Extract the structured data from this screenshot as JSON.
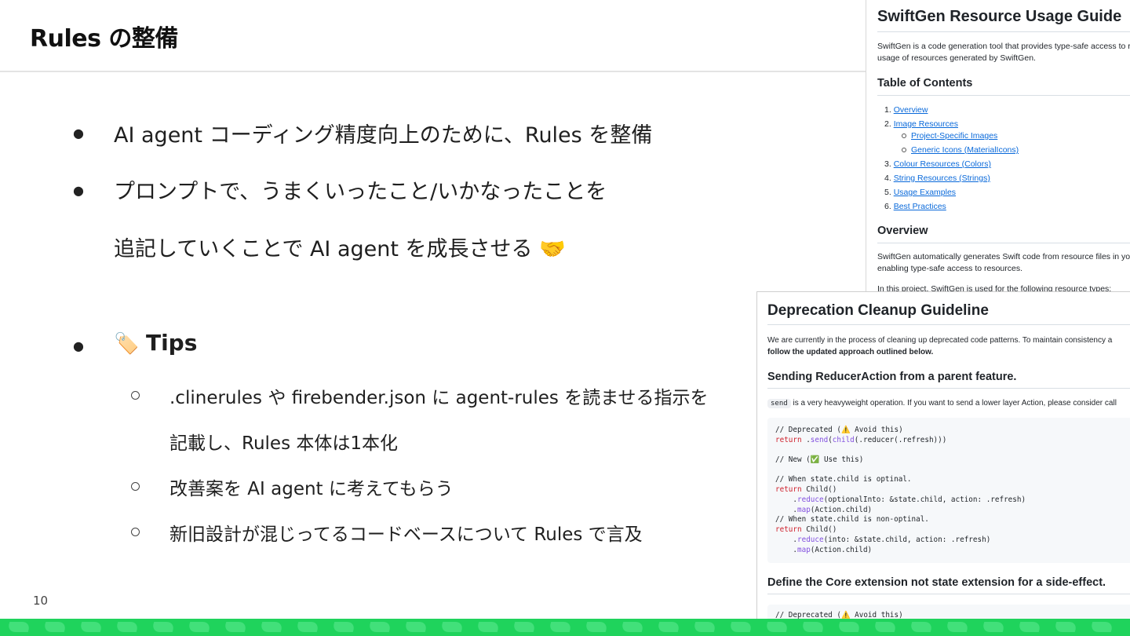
{
  "slide": {
    "title": "Rules の整備",
    "page_number": "10",
    "bullets": [
      {
        "text": "AI agent コーディング精度向上のために、Rules を整備"
      },
      {
        "text_line1": "プロンプトで、うまくいったこと/いかなったことを",
        "text_line2": "追記していくことで AI agent を成長させる 🤝"
      }
    ],
    "tips": {
      "emoji": "🏷️",
      "label": "Tips",
      "items": [
        {
          "line1": ".clinerules や firebender.json に agent-rules を読ませる指示を",
          "line2": "記載し、Rules 本体は1本化"
        },
        {
          "line1": "改善案を AI agent に考えてもらう"
        },
        {
          "line1": "新旧設計が混じってるコードベースについて Rules で言及"
        }
      ]
    },
    "colors": {
      "footer_band": "#1fd35c",
      "leaf": "#42e07a"
    }
  },
  "screenshot1": {
    "title": "SwiftGen Resource Usage Guide",
    "intro_line1": "SwiftGen is a code generation tool that provides type-safe access to r",
    "intro_line2": "usage of resources generated by SwiftGen.",
    "toc_heading": "Table of Contents",
    "toc": [
      {
        "num": "1.",
        "label": "Overview"
      },
      {
        "num": "2.",
        "label": "Image Resources"
      },
      {
        "sub": true,
        "label": "Project-Specific Images"
      },
      {
        "sub": true,
        "label": "Generic Icons (MaterialIcons)"
      },
      {
        "num": "3.",
        "label": "Colour Resources (Colors)"
      },
      {
        "num": "4.",
        "label": "String Resources (Strings)"
      },
      {
        "num": "5.",
        "label": "Usage Examples"
      },
      {
        "num": "6.",
        "label": "Best Practices"
      }
    ],
    "overview_heading": "Overview",
    "overview_line1": "SwiftGen automatically generates Swift code from resource files in yo",
    "overview_line2": "enabling type-safe access to resources.",
    "overview_line3": "In this project, SwiftGen is used for the following resource types:"
  },
  "screenshot2": {
    "title": "Deprecation Cleanup Guideline",
    "intro_line1": "We are currently in the process of cleaning up deprecated code patterns. To maintain consistency a",
    "intro_line2": "follow the updated approach outlined below.",
    "section1_heading": "Sending ReducerAction from a parent feature.",
    "send_code": "send",
    "send_desc": "is a very heavyweight operation. If you want to send a lower layer Action, please consider call",
    "code": {
      "l1_a": "// Deprecated (",
      "l1_emoji": "⚠️",
      "l1_b": " Avoid this)",
      "l2_kw": "return",
      "l2_a": " .",
      "l2_fn1": "send",
      "l2_b": "(",
      "l2_fn2": "child",
      "l2_c": "(.reducer(.refresh)))",
      "l3_a": "// New (",
      "l3_emoji": "✅",
      "l3_b": " Use this)",
      "l4": "// When state.child is optinal.",
      "l5_kw": "return",
      "l5_b": " Child()",
      "l6_a": "    .",
      "l6_fn": "reduce",
      "l6_b": "(optionalInto: &state.child, action: .refresh)",
      "l7_a": "    .",
      "l7_fn": "map",
      "l7_b": "(Action.child)",
      "l8": "// When state.child is non-optinal.",
      "l9_kw": "return",
      "l9_b": " Child()",
      "l10_a": "    .",
      "l10_fn": "reduce",
      "l10_b": "(into: &state.child, action: .refresh)",
      "l11_a": "    .",
      "l11_fn": "map",
      "l11_b": "(Action.child)"
    },
    "section2_heading": "Define the Core extension not state extension for a side-effect.",
    "code2_a": "// Deprecated (",
    "code2_emoji": "⚠️",
    "code2_b": " Avoid this)"
  }
}
